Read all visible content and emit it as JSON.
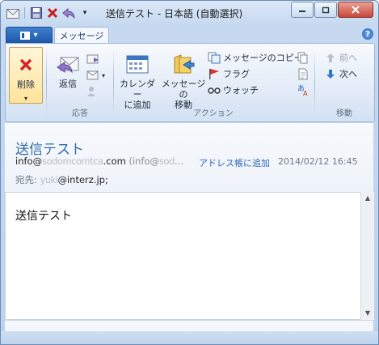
{
  "window": {
    "title": "送信テスト - 日本語 (自動選択)",
    "buttons": [
      "minimize",
      "restore",
      "close"
    ]
  },
  "qat": [
    "outlook-envelope-icon",
    "save-icon",
    "delete-x-icon",
    "reply-icon",
    "customize-dropdown-icon"
  ],
  "tabs": {
    "file_label": "",
    "message_tab": "メッセージ"
  },
  "ribbon": {
    "groups": {
      "delete": {
        "button": "削除"
      },
      "respond": {
        "reply": "返信",
        "label": "応答"
      },
      "actions": {
        "calendar": "カレンダー\nに追加",
        "move": "メッセージの\n移動",
        "copy": "メッセージのコピー",
        "flag": "フラグ",
        "watch": "ウォッチ",
        "label": "アクション"
      },
      "navigate": {
        "prev": "前へ",
        "next": "次へ",
        "label": "移動"
      }
    }
  },
  "message": {
    "subject": "送信テスト",
    "from_prefix": "info@",
    "from_blurred": "sodomcomtca",
    "from_suffix": ".com",
    "from_extra_prefix": "(info@",
    "from_extra_blurred": "sod",
    "from_extra_ellipsis": "…",
    "add_to_addressbook": "アドレス帳に追加",
    "date": "2014/02/12 16:45",
    "to_label": "宛先:",
    "to_blurred": "yuki",
    "to_suffix": "@interz.jp;",
    "body": "送信テスト"
  },
  "colors": {
    "accent": "#2f6aa8",
    "link": "#2a64b5",
    "file_button": "#1d57a8"
  }
}
